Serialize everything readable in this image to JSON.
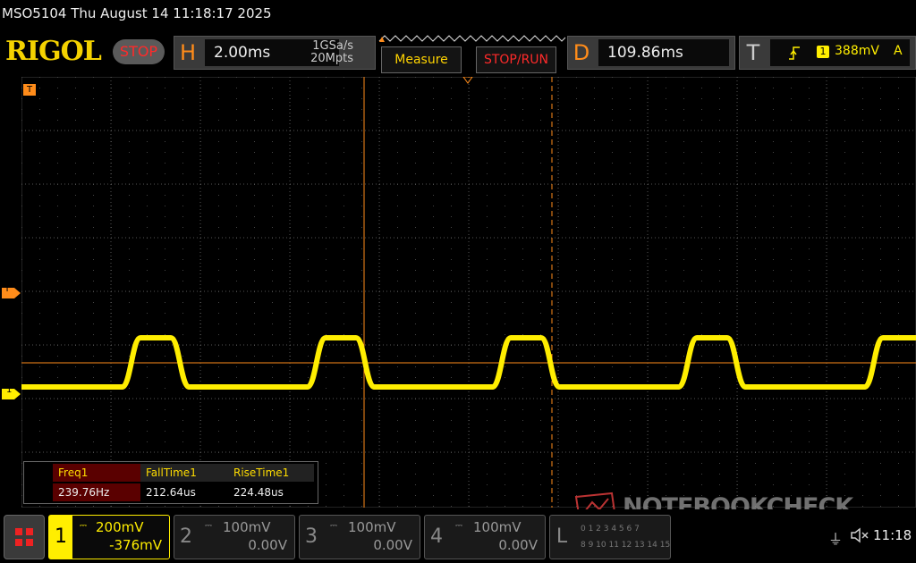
{
  "header": {
    "title": "MSO5104  Thu August 14 11:18:17 2025",
    "logo": "RIGOL",
    "run_state": "STOP"
  },
  "horizontal": {
    "letter": "H",
    "timebase": "2.00ms",
    "sample_rate": "1GSa/s",
    "memory_depth": "20Mpts"
  },
  "buttons": {
    "measure": "Measure",
    "stop_run": "STOP/RUN"
  },
  "delay": {
    "letter": "D",
    "value": "109.86ms"
  },
  "trigger": {
    "letter": "T",
    "source": "1",
    "level": "388mV",
    "mode": "A"
  },
  "markers": {
    "top_trigger": "T",
    "left_trigger": "T",
    "channel1": "1"
  },
  "measurements": [
    {
      "label": "Freq1",
      "value": "239.76Hz"
    },
    {
      "label": "FallTime1",
      "value": "212.64us"
    },
    {
      "label": "RiseTime1",
      "value": "224.48us"
    }
  ],
  "channels": [
    {
      "num": "1",
      "scale": "200mV",
      "offset": "-376mV",
      "color": "#ffee00",
      "active": true
    },
    {
      "num": "2",
      "scale": "100mV",
      "offset": "0.00V",
      "color": "#888888",
      "active": false
    },
    {
      "num": "3",
      "scale": "100mV",
      "offset": "0.00V",
      "color": "#888888",
      "active": false
    },
    {
      "num": "4",
      "scale": "100mV",
      "offset": "0.00V",
      "color": "#888888",
      "active": false
    }
  ],
  "logic": {
    "letter": "L",
    "row1": "0 1 2 3 4 5 6 7",
    "row2": "8 9 10 11 12 13 14 15"
  },
  "status": {
    "time": "11:18"
  },
  "watermark": "NOTEBOOKCHECK",
  "colors": {
    "trace": "#ffee00",
    "accent": "#ff8c1a",
    "stop": "#ff2a2a"
  }
}
